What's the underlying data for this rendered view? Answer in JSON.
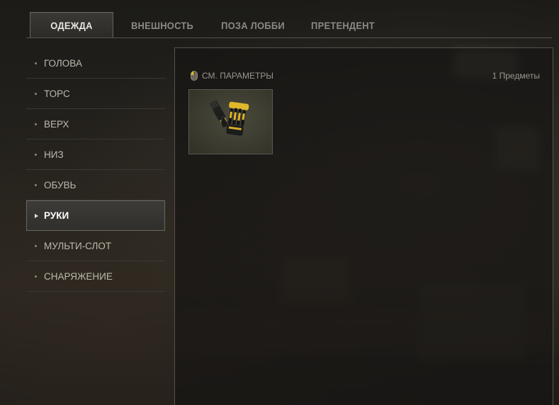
{
  "tabs": [
    {
      "label": "ОДЕЖДА",
      "active": true
    },
    {
      "label": "ВНЕШНОСТЬ",
      "active": false
    },
    {
      "label": "ПОЗА ЛОББИ",
      "active": false
    },
    {
      "label": "ПРЕТЕНДЕНТ",
      "active": false
    }
  ],
  "sidebar": {
    "items": [
      {
        "label": "ГОЛОВА",
        "active": false
      },
      {
        "label": "ТОРС",
        "active": false
      },
      {
        "label": "ВЕРХ",
        "active": false
      },
      {
        "label": "НИЗ",
        "active": false
      },
      {
        "label": "ОБУВЬ",
        "active": false
      },
      {
        "label": "РУКИ",
        "active": true
      },
      {
        "label": "МУЛЬТИ-СЛОТ",
        "active": false
      },
      {
        "label": "СНАРЯЖЕНИЕ",
        "active": false
      }
    ]
  },
  "panel": {
    "params_label": "СМ. ПАРАМЕТРЫ",
    "item_count": "1 Предметы",
    "items": [
      {
        "icon": "gloves-icon"
      }
    ]
  },
  "colors": {
    "accent": "#e0b72b",
    "background": "#1f1d1a",
    "border": "#55524b"
  }
}
